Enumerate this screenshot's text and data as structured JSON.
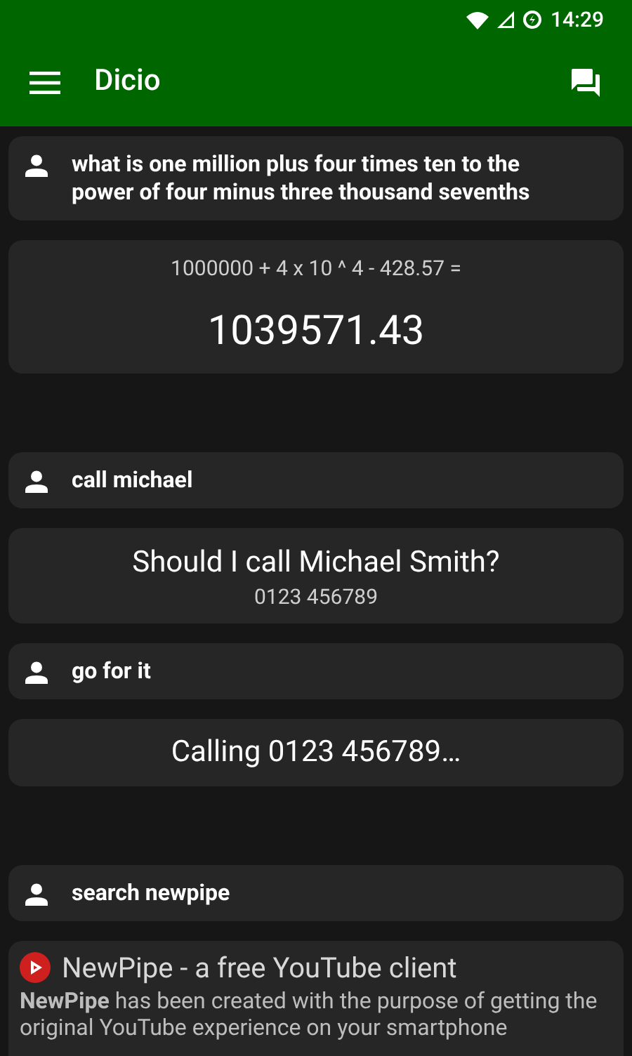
{
  "status_bar": {
    "time": "14:29"
  },
  "app_bar": {
    "title": "Dicio"
  },
  "conversations": [
    [
      {
        "kind": "user",
        "text": "what is one million plus four times ten to the power of four minus three thousand sevenths"
      },
      {
        "kind": "calculation",
        "expression": "1000000 + 4 x 10 ^ 4 - 428.57 =",
        "result": "1039571.43"
      }
    ],
    [
      {
        "kind": "user",
        "text": "call michael"
      },
      {
        "kind": "confirm",
        "title": "Should I call Michael Smith?",
        "subtitle": "0123 456789"
      },
      {
        "kind": "user",
        "text": "go for it"
      },
      {
        "kind": "message",
        "text": "Calling 0123 456789…"
      }
    ],
    [
      {
        "kind": "user",
        "text": "search newpipe"
      },
      {
        "kind": "search_result",
        "title": "NewPipe - a free YouTube client",
        "description": "**NewPipe** has been created with the purpose of getting the original YouTube experience on your smartphone"
      }
    ]
  ]
}
